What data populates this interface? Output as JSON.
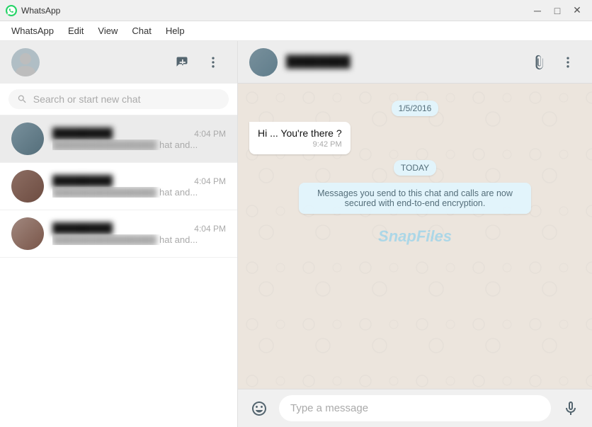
{
  "titlebar": {
    "icon": "whatsapp-icon",
    "title": "WhatsApp",
    "minimize": "─",
    "maximize": "□",
    "close": "✕"
  },
  "menubar": {
    "items": [
      "WhatsApp",
      "Edit",
      "View",
      "Chat",
      "Help"
    ]
  },
  "sidebar": {
    "header": {
      "new_chat_label": "+",
      "more_options_label": "⋯"
    },
    "search": {
      "placeholder": "Search or start new chat"
    },
    "chats": [
      {
        "name": "Contact 1",
        "time": "4:04 PM",
        "preview": "hat and..."
      },
      {
        "name": "Contact 2",
        "time": "4:04 PM",
        "preview": "hat and..."
      },
      {
        "name": "Contact 3",
        "time": "4:04 PM",
        "preview": "hat and..."
      }
    ]
  },
  "chat": {
    "contact_name": "Contact",
    "header_more": "⋯",
    "date_badge": "1/5/2016",
    "today_badge": "TODAY",
    "messages": [
      {
        "type": "received",
        "text": "Hi ... You're there ?",
        "time": "9:42 PM"
      }
    ],
    "info_message": "Messages you send to this chat and calls are now secured with end-to-end encryption.",
    "input_placeholder": "Type a message"
  },
  "watermark": "SnapFiles"
}
